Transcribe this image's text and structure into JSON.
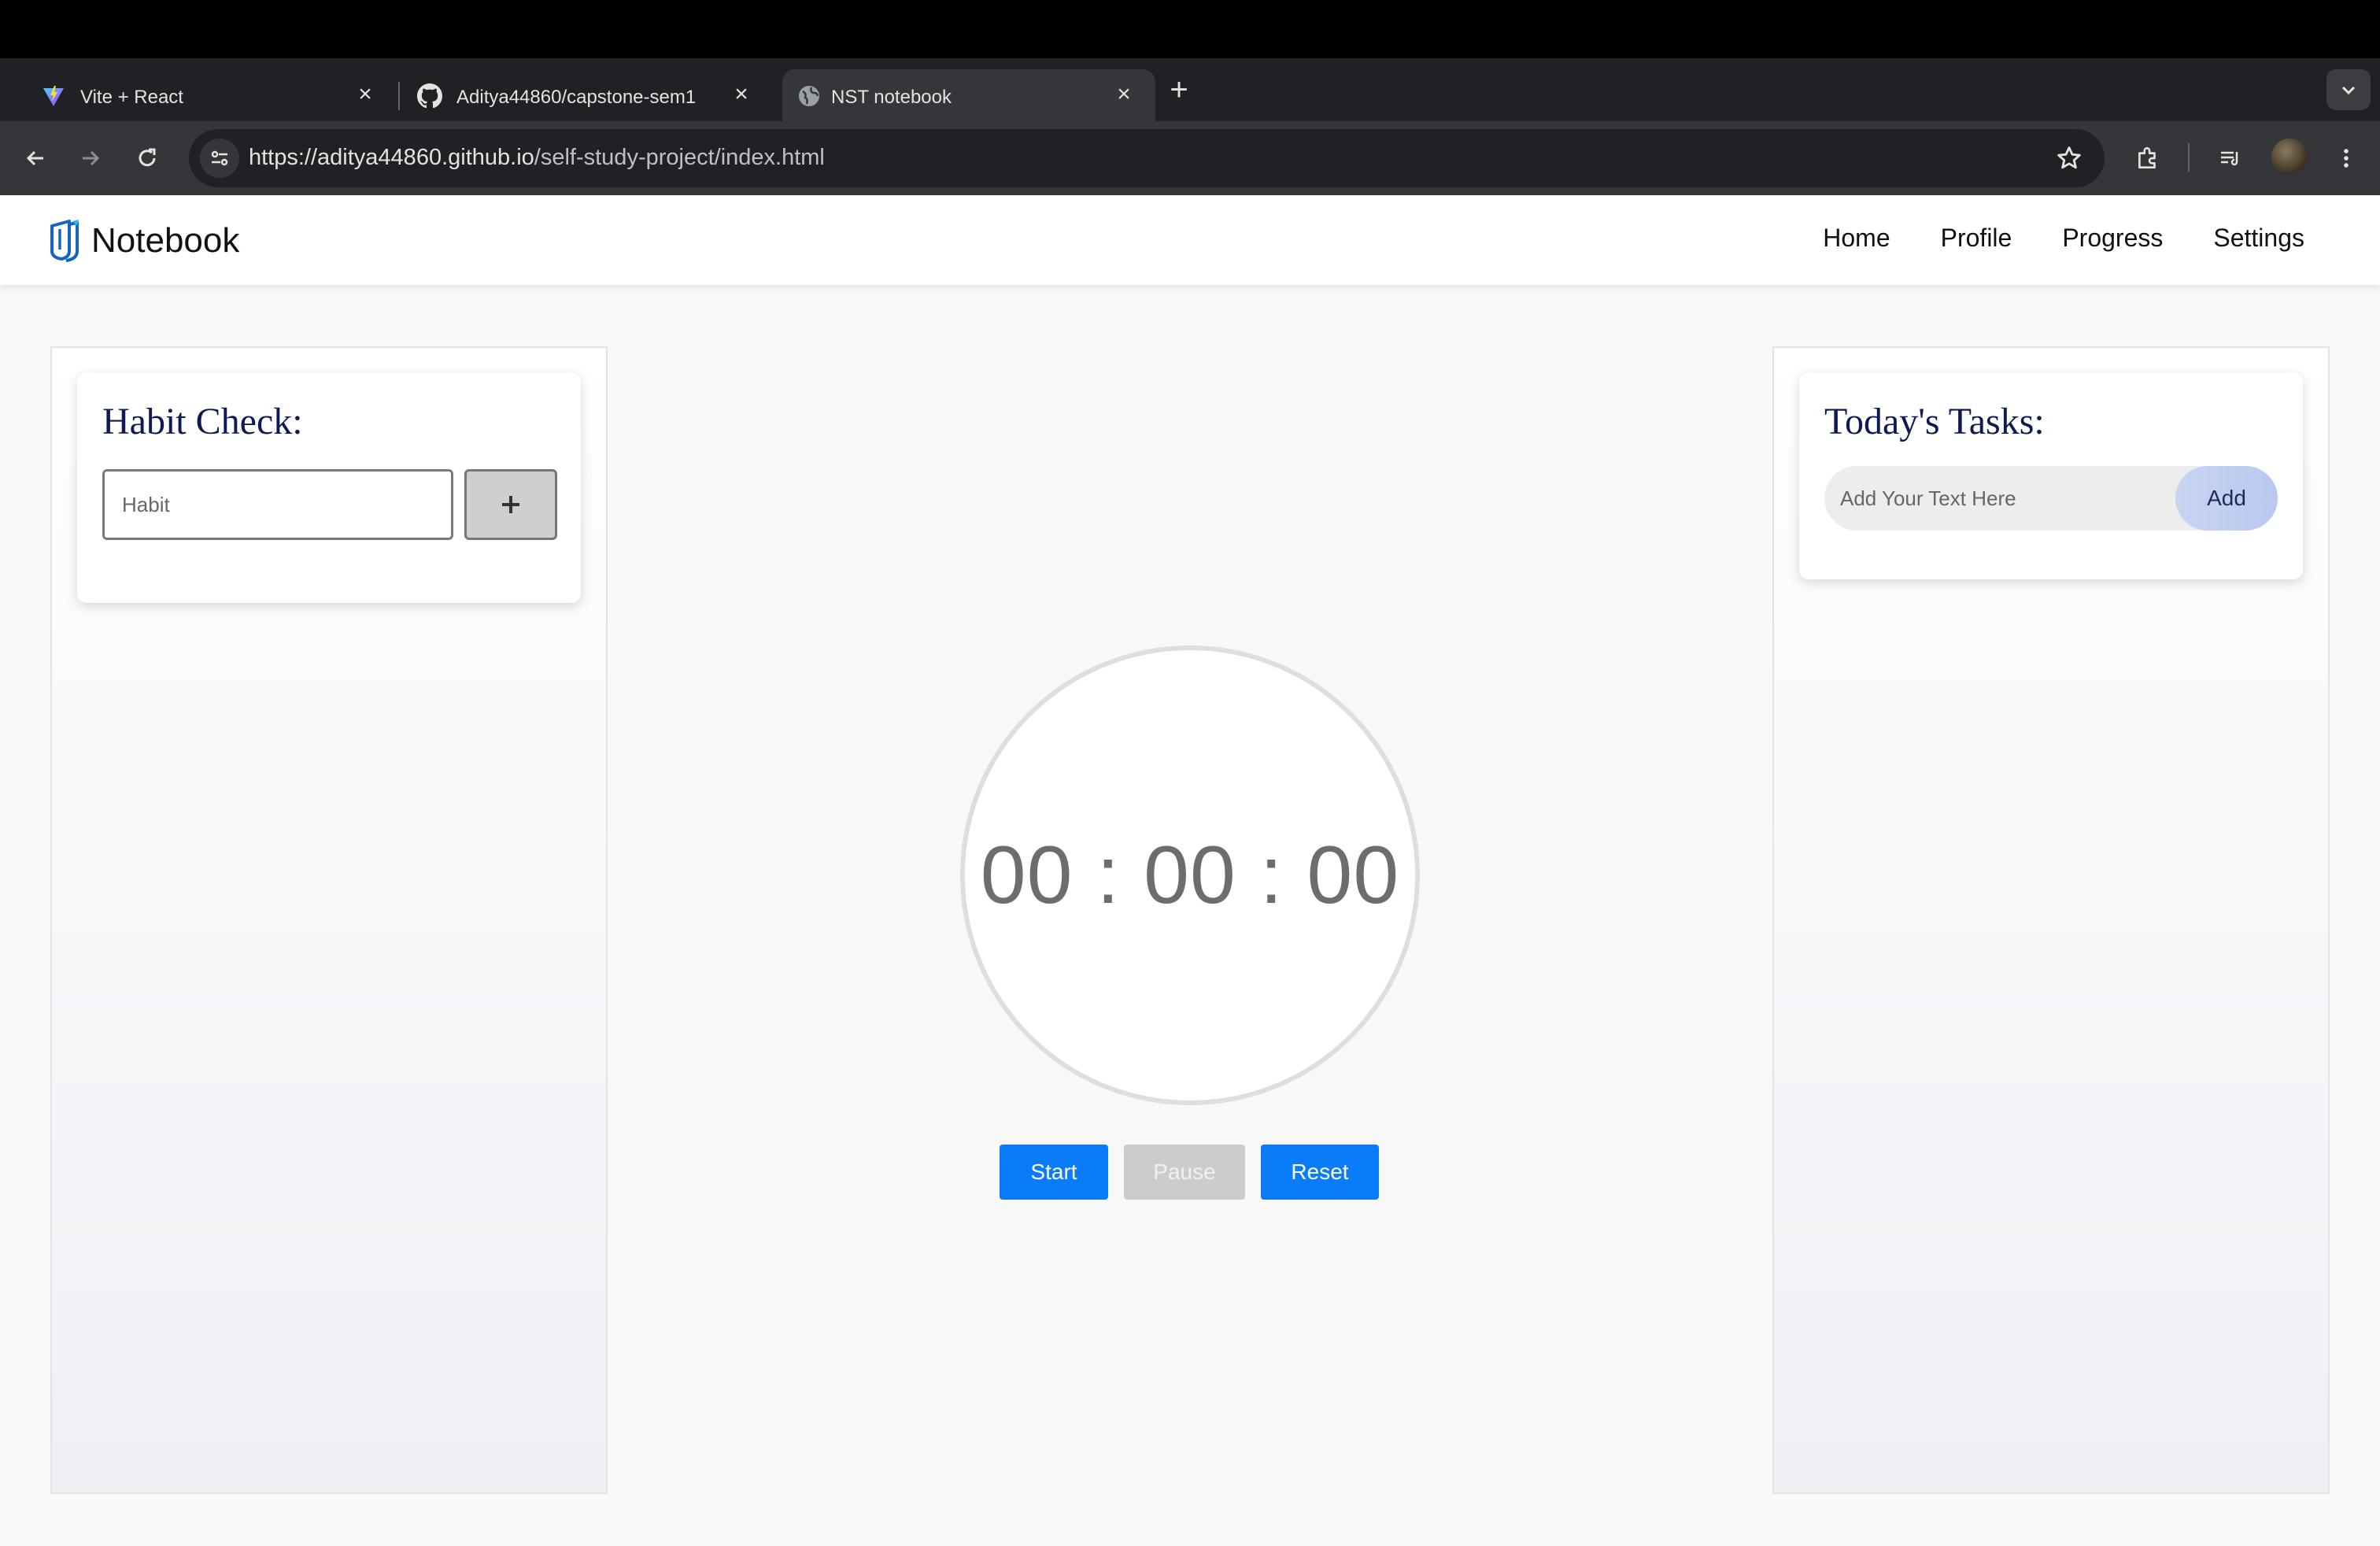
{
  "browser": {
    "tabs": [
      {
        "title": "Vite + React",
        "icon": "vite-icon",
        "active": false
      },
      {
        "title": "Aditya44860/capstone-sem1",
        "icon": "github-icon",
        "active": false
      },
      {
        "title": "NST notebook",
        "icon": "globe-icon",
        "active": true
      }
    ],
    "url_host": "https://aditya44860.github.io",
    "url_path": "/self-study-project/index.html",
    "colors": {
      "chrome_dark": "#202124",
      "chrome_toolbar": "#35363a"
    }
  },
  "navbar": {
    "brand": "Notebook",
    "links": [
      "Home",
      "Profile",
      "Progress",
      "Settings"
    ]
  },
  "habit": {
    "title": "Habit Check:",
    "placeholder": "Habit",
    "add_icon": "plus-icon"
  },
  "tasks": {
    "title": "Today's Tasks:",
    "placeholder": "Add Your Text Here",
    "add_label": "Add"
  },
  "timer": {
    "display": "00 : 00 : 00",
    "start_label": "Start",
    "pause_label": "Pause",
    "reset_label": "Reset",
    "pause_disabled": true,
    "accent_color": "#0a7cf9"
  }
}
